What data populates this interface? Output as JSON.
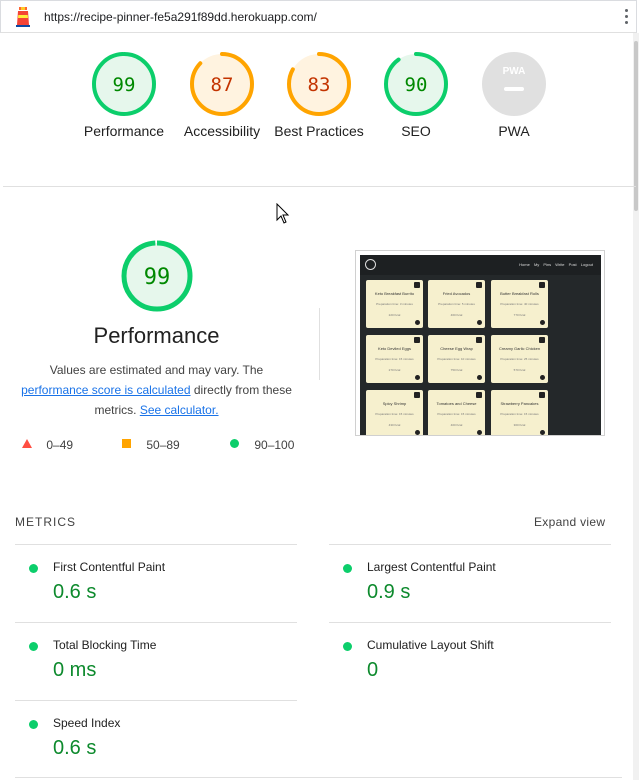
{
  "url": "https://recipe-pinner-fe5a291f89dd.herokuapp.com/",
  "colors": {
    "pass": "#0cce6b",
    "average": "#ffa400",
    "fail": "#ff4e42",
    "pass_text": "#008800",
    "average_text": "#c33300"
  },
  "gauges": [
    {
      "score": "99",
      "label": "Performance",
      "status": "pass",
      "fraction": 0.99
    },
    {
      "score": "87",
      "label": "Accessibility",
      "status": "average",
      "fraction": 0.87
    },
    {
      "score": "83",
      "label": "Best Practices",
      "status": "average",
      "fraction": 0.83
    },
    {
      "score": "90",
      "label": "SEO",
      "status": "pass",
      "fraction": 0.9
    },
    {
      "score": "PWA",
      "label": "PWA",
      "status": "na",
      "fraction": 0
    }
  ],
  "performance": {
    "score": "99",
    "fraction": 0.99,
    "title": "Performance",
    "desc_part1": "Values are estimated and may vary. The ",
    "desc_link1": "performance score is calculated",
    "desc_part2": " directly from these metrics. ",
    "desc_link2": "See calculator."
  },
  "legend": [
    {
      "icon": "triangle-icon",
      "range": "0–49",
      "color": "#ff4e42"
    },
    {
      "icon": "square-icon",
      "range": "50–89",
      "color": "#ffa400"
    },
    {
      "icon": "circle-icon",
      "range": "90–100",
      "color": "#0cce6b"
    }
  ],
  "screenshot": {
    "nav_links": "Home My Pins Write Post Logout",
    "cards": [
      {
        "title": "Keto Breakfast Burrito",
        "meta": "Preparation time: 3 minutes",
        "kcal": "220 Kcal"
      },
      {
        "title": "Fried Avocados",
        "meta": "Preparation time: 5 minutes",
        "kcal": "460 Kcal"
      },
      {
        "title": "Butter Breakfast Rolls",
        "meta": "Preparation time: 40 minutes",
        "kcal": "770 Kcal"
      },
      {
        "title": "Keto Deviled Eggs",
        "meta": "Preparation time: 15 minutes",
        "kcal": "270 Kcal"
      },
      {
        "title": "Cheese Egg Wrap",
        "meta": "Preparation time: 10 minutes",
        "kcal": "750 Kcal"
      },
      {
        "title": "Creamy Garlic Chicken",
        "meta": "Preparation time: 25 minutes",
        "kcal": "570 Kcal"
      },
      {
        "title": "Spicy Shrimp",
        "meta": "Preparation time: 15 minutes",
        "kcal": "430 Kcal"
      },
      {
        "title": "Tomatoes and Cheese",
        "meta": "Preparation time: 15 minutes",
        "kcal": "400 Kcal"
      },
      {
        "title": "Strawberry Pancakes",
        "meta": "Preparation time: 15 minutes",
        "kcal": "300 Kcal"
      }
    ]
  },
  "metrics": {
    "title": "METRICS",
    "expand_label": "Expand view",
    "items": [
      {
        "name": "First Contentful Paint",
        "value": "0.6 s"
      },
      {
        "name": "Largest Contentful Paint",
        "value": "0.9 s"
      },
      {
        "name": "Total Blocking Time",
        "value": "0 ms"
      },
      {
        "name": "Cumulative Layout Shift",
        "value": "0"
      },
      {
        "name": "Speed Index",
        "value": "0.6 s"
      }
    ]
  }
}
